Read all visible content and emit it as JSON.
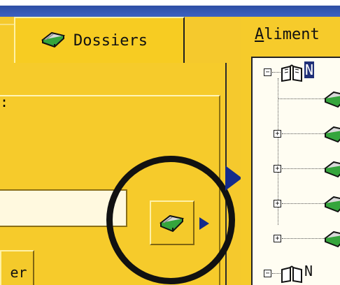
{
  "tabs": {
    "active_label": "Dossiers"
  },
  "left_panel": {
    "top_fragment": ":",
    "button_partial_text": "er"
  },
  "right_panel": {
    "title": "Aliment",
    "title_underlined_char": "A",
    "title_rest": "liment",
    "tree": {
      "root_label_fragment": "N",
      "second_root_fragment": "N",
      "children_count_visible": 5
    }
  },
  "icons": {
    "tab_icon": "book-icon",
    "highlighted_button_icon": "book-icon",
    "tree_root_icon": "open-book-icon",
    "tree_child_icon": "book-icon"
  },
  "colors": {
    "app_yellow": "#f5c92d",
    "title_blue": "#2d4ea4",
    "arrow_blue": "#132b8c",
    "book_green": "#2f9a3b"
  }
}
